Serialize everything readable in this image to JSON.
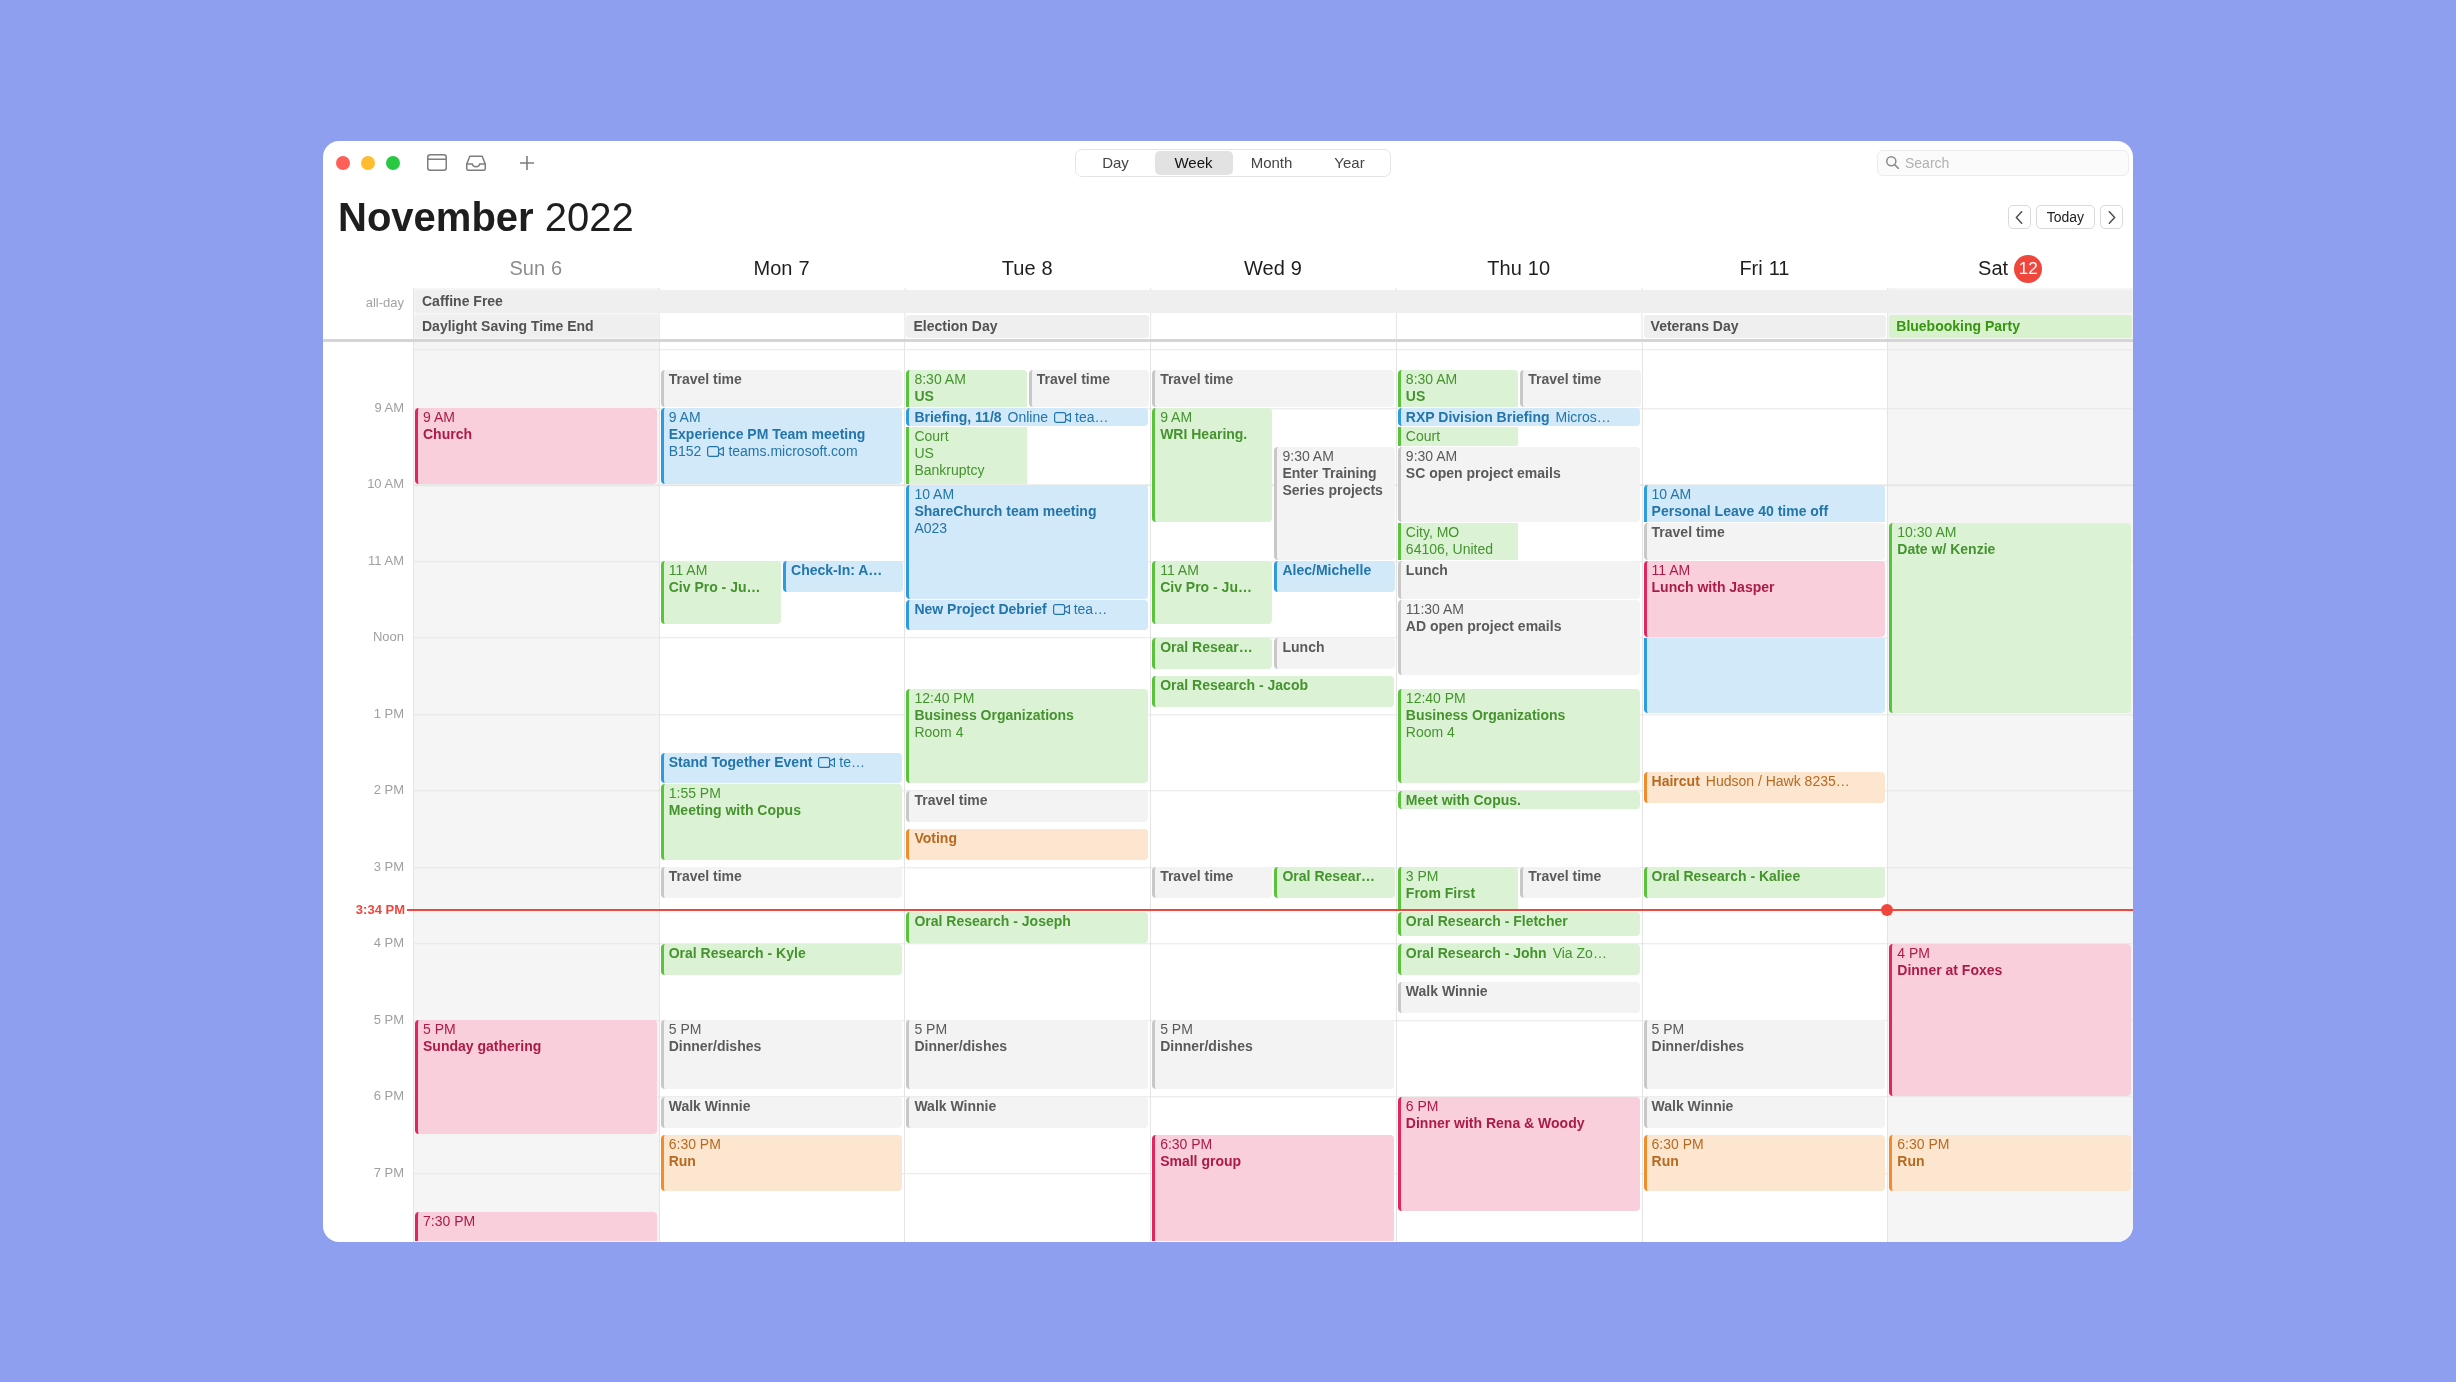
{
  "toolbar": {
    "views": [
      {
        "label": "Day",
        "selected": false
      },
      {
        "label": "Week",
        "selected": true
      },
      {
        "label": "Month",
        "selected": false
      },
      {
        "label": "Year",
        "selected": false
      }
    ],
    "search": {
      "placeholder": "Search"
    }
  },
  "header": {
    "title": "**November** 2022",
    "today_button": "Today"
  },
  "all_day_label": "all-day",
  "hours": [
    "9 AM",
    "10 AM",
    "11 AM",
    "Noon",
    "1 PM",
    "2 PM",
    "3 PM",
    "4 PM",
    "5 PM",
    "6 PM",
    "7 PM"
  ],
  "current_time": "3:34 PM",
  "days": [
    {
      "weekday": "Sun",
      "date": "6",
      "weekend": true,
      "today": false,
      "all_day": [
        {
          "title": "Caffine Free",
          "color": "#efefef",
          "multi_day": true
        },
        {
          "title": "Daylight Saving Time End",
          "color": "#efefef",
          "multi_day": false
        }
      ],
      "events": [
        {
          "time": "9 AM",
          "title": "Church",
          "color": "#e2245f"
        },
        {
          "time": "5 PM",
          "title": "Sunday gathering",
          "color": "#e2245f"
        },
        {
          "time": "7:30 PM",
          "color": "#e2245f"
        }
      ]
    },
    {
      "weekday": "Mon",
      "date": "7",
      "weekend": false,
      "today": false,
      "events": [
        {
          "title": "Travel time",
          "color": "#c8c8c8"
        },
        {
          "time": "9 AM",
          "title": "Experience PM Team meeting",
          "location": "B152",
          "video": true,
          "link": "teams.microsoft.com",
          "color": "#2e9ae0"
        },
        {
          "time": "11 AM",
          "title": "Civ Pro - Ju…",
          "color": "#5bc23c"
        },
        {
          "title": "Check-In: A…",
          "color": "#2e9ae0"
        },
        {
          "title": "Stand Together Event",
          "video": true,
          "link": "te…",
          "color": "#2e9ae0"
        },
        {
          "time": "1:55 PM",
          "title": "Meeting with Copus",
          "color": "#5bc23c"
        },
        {
          "title": "Travel time",
          "color": "#c8c8c8"
        },
        {
          "title": "Oral Research - Kyle",
          "color": "#5bc23c"
        },
        {
          "time": "5 PM",
          "title": "Dinner/dishes",
          "color": "#c8c8c8"
        },
        {
          "title": "Walk Winnie",
          "color": "#c8c8c8"
        },
        {
          "time": "6:30 PM",
          "title": "Run",
          "color": "#f08c2a"
        }
      ]
    },
    {
      "weekday": "Tue",
      "date": "8",
      "weekend": false,
      "today": false,
      "all_day": [
        {
          "title": "Election Day",
          "color": "#efefef",
          "multi_day": false
        }
      ],
      "events": [
        {
          "time": "8:30 AM",
          "title": "US",
          "lines": [
            "Court",
            "US",
            "Bankruptcy"
          ],
          "color": "#5bc23c"
        },
        {
          "title": "Travel time",
          "color": "#c8c8c8"
        },
        {
          "title": "Briefing, 11/8",
          "location": "Online",
          "video": true,
          "link": "tea…",
          "color": "#2e9ae0"
        },
        {
          "time": "10 AM",
          "title": "ShareChurch team meeting",
          "location": "A023",
          "color": "#2e9ae0"
        },
        {
          "title": "New Project Debrief",
          "video": true,
          "link": "tea…",
          "color": "#2e9ae0"
        },
        {
          "time": "12:40 PM",
          "title": "Business Organizations",
          "location": "Room 4",
          "color": "#5bc23c"
        },
        {
          "title": "Travel time",
          "color": "#c8c8c8"
        },
        {
          "title": "Voting",
          "color": "#f08c2a"
        },
        {
          "title": "Oral Research - Joseph",
          "color": "#5bc23c"
        },
        {
          "time": "5 PM",
          "title": "Dinner/dishes",
          "color": "#c8c8c8"
        },
        {
          "title": "Walk Winnie",
          "color": "#c8c8c8"
        }
      ]
    },
    {
      "weekday": "Wed",
      "date": "9",
      "weekend": false,
      "today": false,
      "events": [
        {
          "title": "Travel time",
          "color": "#c8c8c8"
        },
        {
          "time": "9 AM",
          "title": "WRI Hearing.",
          "color": "#5bc23c"
        },
        {
          "time": "9:30 AM",
          "title": "Enter Training Series projects",
          "color": "#c8c8c8"
        },
        {
          "time": "11 AM",
          "title": "Civ Pro - Ju…",
          "color": "#5bc23c"
        },
        {
          "title": "Alec/Michelle",
          "color": "#2e9ae0"
        },
        {
          "title": "Oral Resear…",
          "color": "#5bc23c"
        },
        {
          "title": "Lunch",
          "color": "#c8c8c8"
        },
        {
          "title": "Oral Research - Jacob",
          "color": "#5bc23c"
        },
        {
          "title": "Travel time",
          "color": "#c8c8c8"
        },
        {
          "title": "Oral Resear…",
          "color": "#5bc23c"
        },
        {
          "time": "5 PM",
          "title": "Dinner/dishes",
          "color": "#c8c8c8"
        },
        {
          "time": "6:30 PM",
          "title": "Small group",
          "color": "#e2245f"
        }
      ]
    },
    {
      "weekday": "Thu",
      "date": "10",
      "weekend": false,
      "today": false,
      "events": [
        {
          "time": "8:30 AM",
          "title": "US",
          "lines": [
            "Court",
            "City, MO",
            "64106, United"
          ],
          "color": "#5bc23c"
        },
        {
          "title": "Travel time",
          "color": "#c8c8c8"
        },
        {
          "title": "RXP Division Briefing",
          "location": "Micros…",
          "color": "#2e9ae0"
        },
        {
          "time": "9:30 AM",
          "title": "SC open project emails",
          "color": "#c8c8c8"
        },
        {
          "title": "Lunch",
          "color": "#c8c8c8"
        },
        {
          "time": "11:30 AM",
          "title": "AD open project emails",
          "color": "#c8c8c8"
        },
        {
          "time": "12:40 PM",
          "title": "Business Organizations",
          "location": "Room 4",
          "color": "#5bc23c"
        },
        {
          "title": "Meet with Copus.",
          "color": "#5bc23c"
        },
        {
          "time": "3 PM",
          "title": "From First",
          "color": "#5bc23c"
        },
        {
          "title": "Travel time",
          "color": "#c8c8c8"
        },
        {
          "title": "Oral Research - Fletcher",
          "color": "#5bc23c"
        },
        {
          "title": "Oral Research - John",
          "location": "Via Zo…",
          "color": "#5bc23c"
        },
        {
          "title": "Walk Winnie",
          "color": "#c8c8c8"
        },
        {
          "time": "6 PM",
          "title": "Dinner with Rena & Woody",
          "color": "#e2245f"
        }
      ]
    },
    {
      "weekday": "Fri",
      "date": "11",
      "weekend": false,
      "today": false,
      "all_day": [
        {
          "title": "Veterans Day",
          "color": "#efefef",
          "multi_day": false
        }
      ],
      "events": [
        {
          "time": "10 AM",
          "title": "Personal Leave 40 time off",
          "color": "#2e9ae0"
        },
        {
          "title": "Travel time",
          "color": "#c8c8c8"
        },
        {
          "time": "11 AM",
          "title": "Lunch with Jasper",
          "color": "#e2245f"
        },
        {
          "title": "Haircut",
          "location": "Hudson / Hawk 8235…",
          "color": "#f08c2a"
        },
        {
          "title": "Oral Research - Kaliee",
          "color": "#5bc23c"
        },
        {
          "time": "5 PM",
          "title": "Dinner/dishes",
          "color": "#c8c8c8"
        },
        {
          "title": "Walk Winnie",
          "color": "#c8c8c8"
        },
        {
          "time": "6:30 PM",
          "title": "Run",
          "color": "#f08c2a"
        }
      ]
    },
    {
      "weekday": "Sat",
      "date": "12",
      "weekend": true,
      "today": true,
      "all_day": [
        {
          "title": "Bluebooking Party",
          "color": "#d7f2cc",
          "multi_day": false
        }
      ],
      "events": [
        {
          "time": "10:30 AM",
          "title": "Date w/ Kenzie",
          "color": "#5bc23c"
        },
        {
          "time": "4 PM",
          "title": "Dinner at Foxes",
          "color": "#e2245f"
        },
        {
          "time": "6:30 PM",
          "title": "Run",
          "color": "#f08c2a"
        }
      ]
    }
  ]
}
